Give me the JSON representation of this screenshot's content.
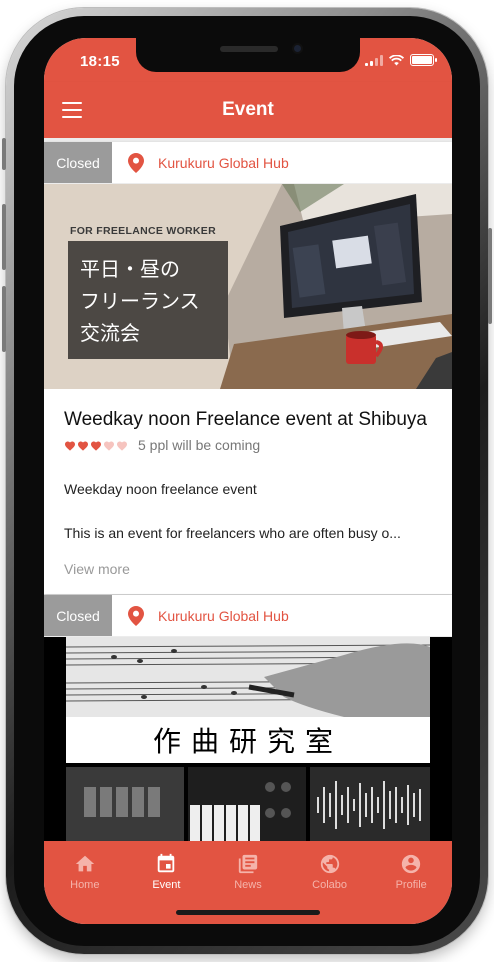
{
  "status": {
    "time": "18:15"
  },
  "header": {
    "title": "Event"
  },
  "events": [
    {
      "status_badge": "Closed",
      "location": "Kurukuru Global Hub",
      "banner_caption": "FOR FREELANCE WORKER",
      "banner_title": "平日・昼の\nフリーランス\n交流会",
      "title": "Weedkay noon Freelance event at Shibuya",
      "rating": 3,
      "rating_max": 5,
      "attendees": "5 ppl will be coming",
      "subtitle": "Weekday noon freelance event",
      "description": "This is an event for freelancers who are often busy o...",
      "view_more": "View more"
    },
    {
      "status_badge": "Closed",
      "location": "Kurukuru Global Hub",
      "banner_title": "作曲研究室"
    }
  ],
  "nav": {
    "items": [
      {
        "label": "Home",
        "icon": "home-icon"
      },
      {
        "label": "Event",
        "icon": "calendar-icon"
      },
      {
        "label": "News",
        "icon": "news-icon"
      },
      {
        "label": "Colabo",
        "icon": "globe-icon"
      },
      {
        "label": "Profile",
        "icon": "profile-icon"
      }
    ],
    "active": "Event"
  },
  "colors": {
    "primary": "#e25442",
    "badge": "#9b9b9b",
    "heart": "#e25442",
    "heart_empty": "#f6c4bf"
  }
}
